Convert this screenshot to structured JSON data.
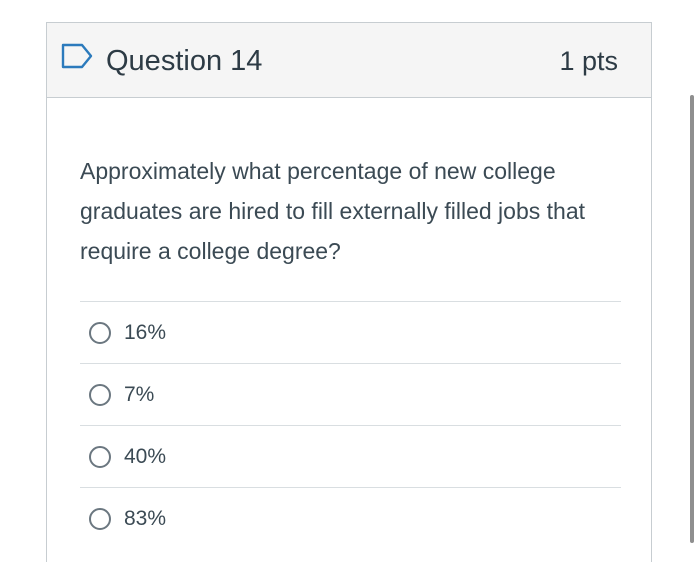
{
  "question": {
    "title": "Question 14",
    "points": "1 pts",
    "text": "Approximately what percentage of new college graduates are hired to fill externally filled jobs that require a college degree?",
    "flag_icon": "flag-outline-icon"
  },
  "answers": [
    {
      "label": "16%"
    },
    {
      "label": "7%"
    },
    {
      "label": "40%"
    },
    {
      "label": "83%"
    }
  ],
  "colors": {
    "header_bg": "#f5f5f5",
    "border": "#c7cdd1",
    "flag": "#2b7abc",
    "text": "#2d3b45"
  }
}
